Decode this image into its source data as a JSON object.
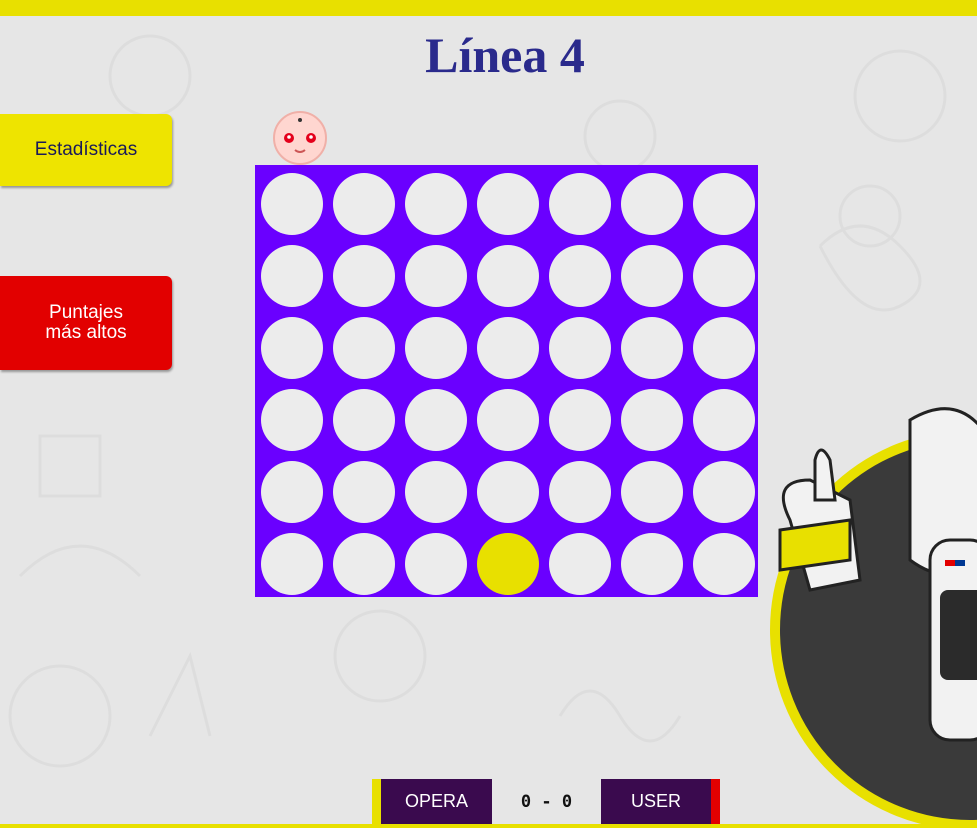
{
  "title": "Línea 4",
  "sidebar": {
    "stats_label": "Estadísticas",
    "scores_label_line1": "Puntajes",
    "scores_label_line2": "más altos"
  },
  "board": {
    "columns": 7,
    "rows": 6,
    "pieces": [
      {
        "row": 5,
        "col": 3,
        "player": "user"
      }
    ]
  },
  "scoreboard": {
    "left_player": "OPERA",
    "score": "0 - 0",
    "right_player": "USER"
  },
  "colors": {
    "board": "#6a00ff",
    "empty_cell": "#ececec",
    "user_piece": "#e8e000",
    "accent_yellow": "#e8e000",
    "accent_red": "#e20000",
    "title": "#2a2a8c"
  },
  "icons": {
    "opponent_avatar": "baby-face-icon",
    "mascot": "robot-thumbs-up-icon"
  }
}
